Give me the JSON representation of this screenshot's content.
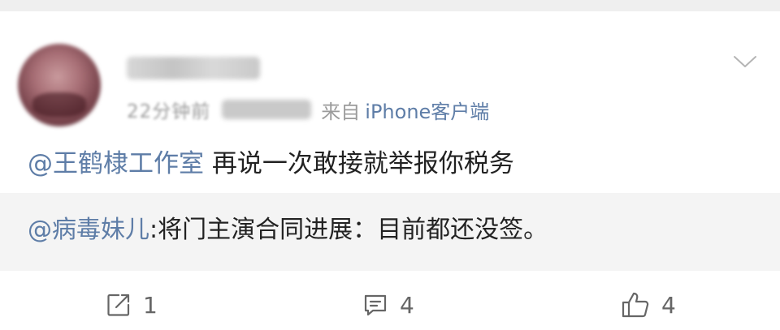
{
  "post": {
    "time": "22分钟前",
    "from_label": "来自",
    "source": "iPhone客户端",
    "mention": "@王鹤棣工作室",
    "text": " 再说一次敢接就举报你税务"
  },
  "repost": {
    "mention": "@病毒妹儿",
    "text": ":将门主演合同进展：目前都还没签。"
  },
  "actions": {
    "share_count": "1",
    "comment_count": "4",
    "like_count": "4"
  },
  "colors": {
    "link": "#5e7da7",
    "text": "#222222",
    "muted": "#9b9b9b",
    "repost_bg": "#f4f4f4",
    "page_bg": "#efefef"
  },
  "icons": [
    "chevron-down-icon",
    "share-icon",
    "comment-icon",
    "thumbs-up-icon"
  ]
}
